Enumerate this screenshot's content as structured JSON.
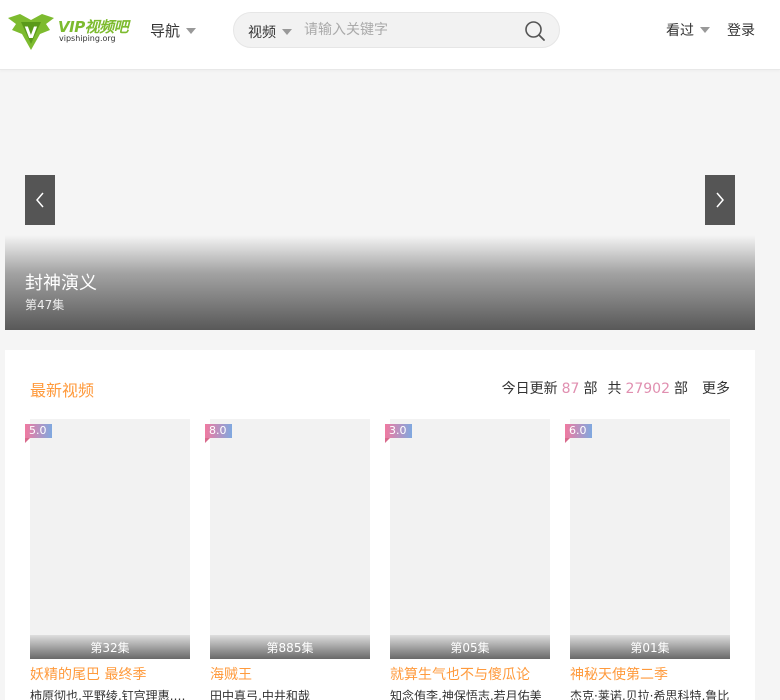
{
  "header": {
    "logo_text": "VIP视频吧",
    "logo_sub": "vipshiping.org",
    "nav_label": "导航",
    "search": {
      "type_label": "视频",
      "placeholder": "请输入关键字"
    },
    "history_label": "看过",
    "login_label": "登录"
  },
  "banner": {
    "title": "封神演义",
    "subtitle": "第47集"
  },
  "latest": {
    "section_title": "最新视频",
    "today_label": "今日更新",
    "today_count": "87",
    "unit": "部",
    "total_label": "共",
    "total_count": "27902",
    "more_label": "更多",
    "cards": [
      {
        "score": "5.0",
        "episode": "第32集",
        "title": "妖精的尾巴 最终季",
        "actors": "柿原彻也,平野绫,钉宫理惠,大原沙耶香"
      },
      {
        "score": "8.0",
        "episode": "第885集",
        "title": "海贼王",
        "actors": "田中真弓,中井和哉"
      },
      {
        "score": "3.0",
        "episode": "第05集",
        "title": "就算生气也不与傻瓜论",
        "actors": "知念侑李,神保悟志,若月佑美"
      },
      {
        "score": "6.0",
        "episode": "第01集",
        "title": "神秘天使第二季",
        "actors": "杰克·莱诺,贝拉·希思科特,鲁比"
      }
    ]
  },
  "colors": {
    "accent": "#ff9a3c",
    "count": "#e08fb0",
    "logo": "#7dbb2f"
  }
}
